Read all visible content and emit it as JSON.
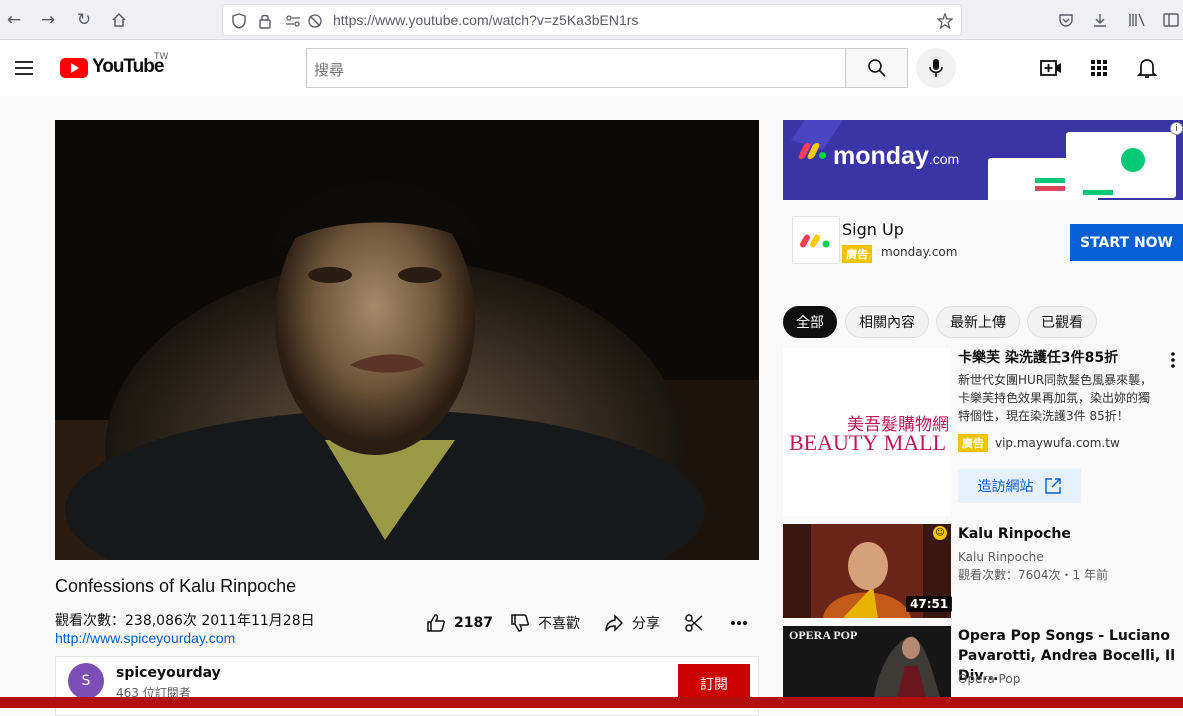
{
  "browser": {
    "url": "https://www.youtube.com/watch?v=z5Ka3bEN1rs"
  },
  "header": {
    "logo_text": "YouTube",
    "logo_region": "TW",
    "search_placeholder": "搜尋"
  },
  "video": {
    "title": "Confessions of Kalu Rinpoche",
    "views": "觀看次數：238,086次",
    "date": "2011年11月28日",
    "description_link": "http://www.spiceyourday.com",
    "likes": "2187",
    "dislike_label": "不喜歡",
    "share_label": "分享"
  },
  "channel": {
    "avatar_letter": "S",
    "name": "spiceyourday",
    "subscribers": "463 位訂閱者",
    "subscribe_label": "訂閱"
  },
  "ad": {
    "banner_brand": "monday",
    "banner_brand_suffix": ".com",
    "title": "Sign Up",
    "tag": "廣告",
    "domain": "monday.com",
    "cta": "START NOW"
  },
  "chips": [
    "全部",
    "相關內容",
    "最新上傳",
    "已觀看"
  ],
  "sidebar": {
    "ad_item": {
      "title": "卡樂芙 染洗護任3件85折",
      "desc_lines": [
        "新世代女團HUR同款髮色風暴來襲，",
        "卡樂芙持色效果再加氛，染出妳的獨",
        "特個性，現在染洗護3件 85折！"
      ],
      "tag": "廣告",
      "domain": "vip.maywufa.com.tw",
      "thumb_text_cn": "美吾髮購物網",
      "thumb_text_en1": "BEAUTY",
      "thumb_text_en2": "MALL",
      "visit_label": "造訪網站"
    },
    "items": [
      {
        "title": "Kalu Rinpoche",
        "channel": "Kalu Rinpoche",
        "meta": "觀看次數：7604次・1 年前",
        "duration": "47:51"
      },
      {
        "title_line1": "Opera Pop Songs - Luciano",
        "title_line2": "Pavarotti, Andrea Bocelli, Il Div...",
        "channel": "Opera Pop",
        "thumb_text": "OPERA POP"
      }
    ]
  },
  "colors": {
    "yt_red": "#ff0000",
    "link_blue": "#065fd4",
    "subscribe_red": "#cc0000",
    "ad_yellow": "#f2c400",
    "monday_purple": "#3a35a6"
  }
}
